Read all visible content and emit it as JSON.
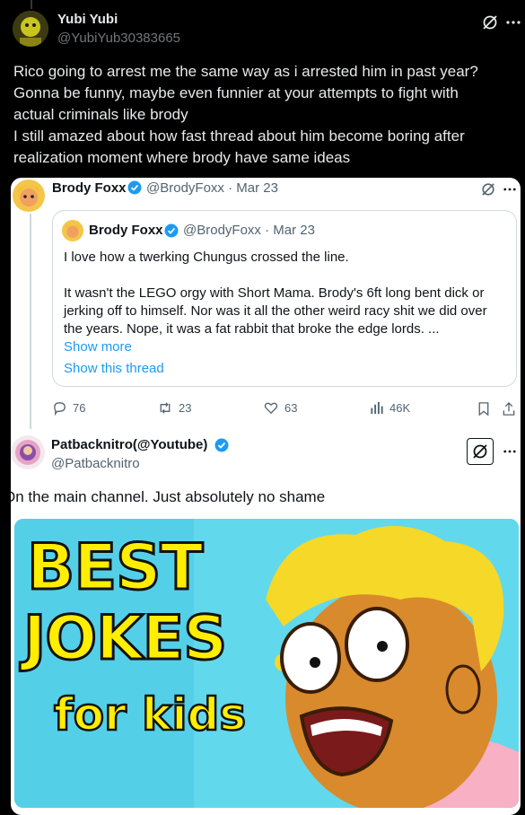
{
  "tweet": {
    "author_name": "Yubi Yubi",
    "author_handle": "@YubiYub30383665",
    "text_lines": [
      "Rico going to arrest me the same way as i arrested him in past year?",
      "Gonna be funny, maybe even funnier at your attempts to fight with",
      "actual criminals like brody",
      "I still amazed about how fast thread about him become boring after",
      "realization moment where brody have same ideas"
    ]
  },
  "embedded": {
    "tweet1": {
      "author_name": "Brody Foxx",
      "handle_date": "@BrodyFoxx · Mar 23",
      "quote": {
        "author_name": "Brody Foxx",
        "handle_date": "@BrodyFoxx · Mar 23",
        "line1": "I love how a twerking Chungus crossed the line.",
        "body_lines": [
          "It wasn't the LEGO orgy with Short Mama. Brody's 6ft long bent dick or",
          "jerking off to himself. Nor was it all the other weird racy shit we did over",
          "the years. Nope, it was a fat rabbit that broke the edge lords. ..."
        ],
        "show_more": "Show more",
        "show_thread": "Show this thread"
      },
      "stats": {
        "replies": "76",
        "reposts": "23",
        "likes": "63",
        "views": "46K"
      }
    },
    "tweet2": {
      "author_name": "Patbacknitro(@Youtube)",
      "author_handle": "@Patbacknitro",
      "text": "On the main channel. Just absolutely no shame",
      "thumbnail": {
        "line1": "BEST",
        "line2": "JOKES",
        "line3": "for kids"
      }
    }
  },
  "colors": {
    "accent": "#1d9bf0",
    "thumbnail_text": "#ffee00",
    "thumbnail_bg": "#53d0e8"
  }
}
